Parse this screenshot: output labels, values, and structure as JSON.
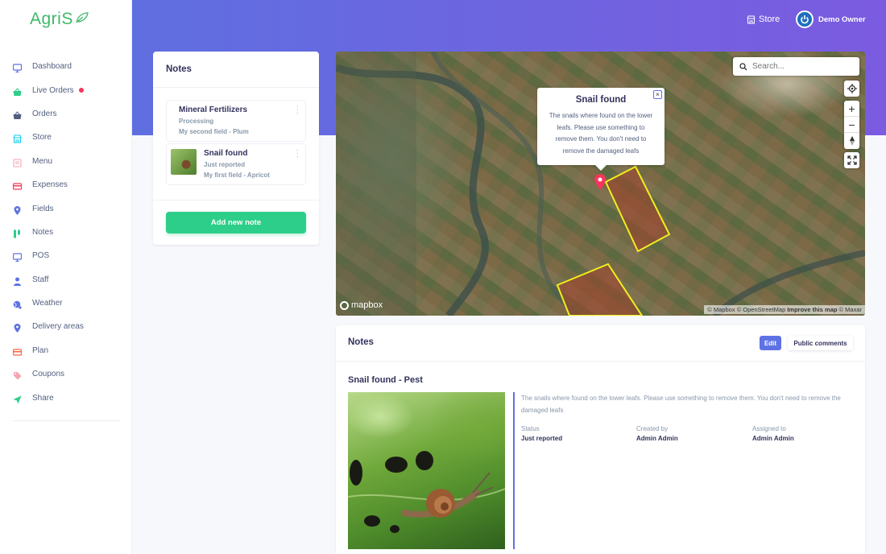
{
  "brand": {
    "name": "AgriS"
  },
  "sidebar": {
    "items": [
      {
        "label": "Dashboard",
        "icon": "monitor-icon",
        "color": "#5e72e4"
      },
      {
        "label": "Live Orders",
        "icon": "basket-icon",
        "color": "#2dce89",
        "badge_dot": true
      },
      {
        "label": "Orders",
        "icon": "basket-icon",
        "color": "#525f7f"
      },
      {
        "label": "Store",
        "icon": "shop-icon",
        "color": "#11cdef"
      },
      {
        "label": "Menu",
        "icon": "book-icon",
        "color": "#f5a3b4"
      },
      {
        "label": "Expenses",
        "icon": "credit-card-icon",
        "color": "#f5365c"
      },
      {
        "label": "Fields",
        "icon": "map-pin-icon",
        "color": "#5e72e4"
      },
      {
        "label": "Notes",
        "icon": "notes-icon",
        "color": "#2dce89"
      },
      {
        "label": "POS",
        "icon": "monitor-icon",
        "color": "#5e72e4"
      },
      {
        "label": "Staff",
        "icon": "user-icon",
        "color": "#5e72e4"
      },
      {
        "label": "Weather",
        "icon": "globe-icon",
        "color": "#5e72e4"
      },
      {
        "label": "Delivery areas",
        "icon": "map-pin-icon",
        "color": "#5e72e4"
      },
      {
        "label": "Plan",
        "icon": "credit-card-icon",
        "color": "#fb6340"
      },
      {
        "label": "Coupons",
        "icon": "tag-icon",
        "color": "#f5a3b4"
      },
      {
        "label": "Share",
        "icon": "send-icon",
        "color": "#2dce89"
      }
    ]
  },
  "topbar": {
    "store_label": "Store",
    "user_name": "Demo Owner"
  },
  "notes_list": {
    "title": "Notes",
    "items": [
      {
        "title": "Mineral Fertilizers",
        "status": "Processing",
        "field": "My second field - Plum",
        "has_thumb": false
      },
      {
        "title": "Snail found",
        "status": "Just reported",
        "field": "My first field - Apricot",
        "has_thumb": true
      }
    ],
    "add_button": "Add new note"
  },
  "map": {
    "search_placeholder": "Search...",
    "popup": {
      "title": "Snail found",
      "description": "The snails where found on the lower leafs. Please use something to remove them. You don't need to remove the damaged leafs",
      "close": "×"
    },
    "logo_text": "mapbox",
    "attribution": {
      "copy1": "© Mapbox",
      "copy2": "© OpenStreetMap",
      "improve": "Improve this map",
      "copy3": "© Maxar"
    }
  },
  "detail": {
    "title": "Notes",
    "edit_button": "Edit",
    "public_comments_button": "Public comments",
    "note_title": "Snail found - Pest",
    "description": "The snails where found on the lower leafs. Please use something to remove them. You don't need to remove the damaged leafs",
    "meta": [
      {
        "label": "Status",
        "value": "Just reported"
      },
      {
        "label": "Created by",
        "value": "Admin Admin"
      },
      {
        "label": "Assigned to",
        "value": "Admin Admin"
      }
    ]
  },
  "colors": {
    "brand_green": "#3fb86a",
    "primary": "#5e72e4",
    "success": "#2dce89",
    "field_outline": "#f2ee1d"
  }
}
